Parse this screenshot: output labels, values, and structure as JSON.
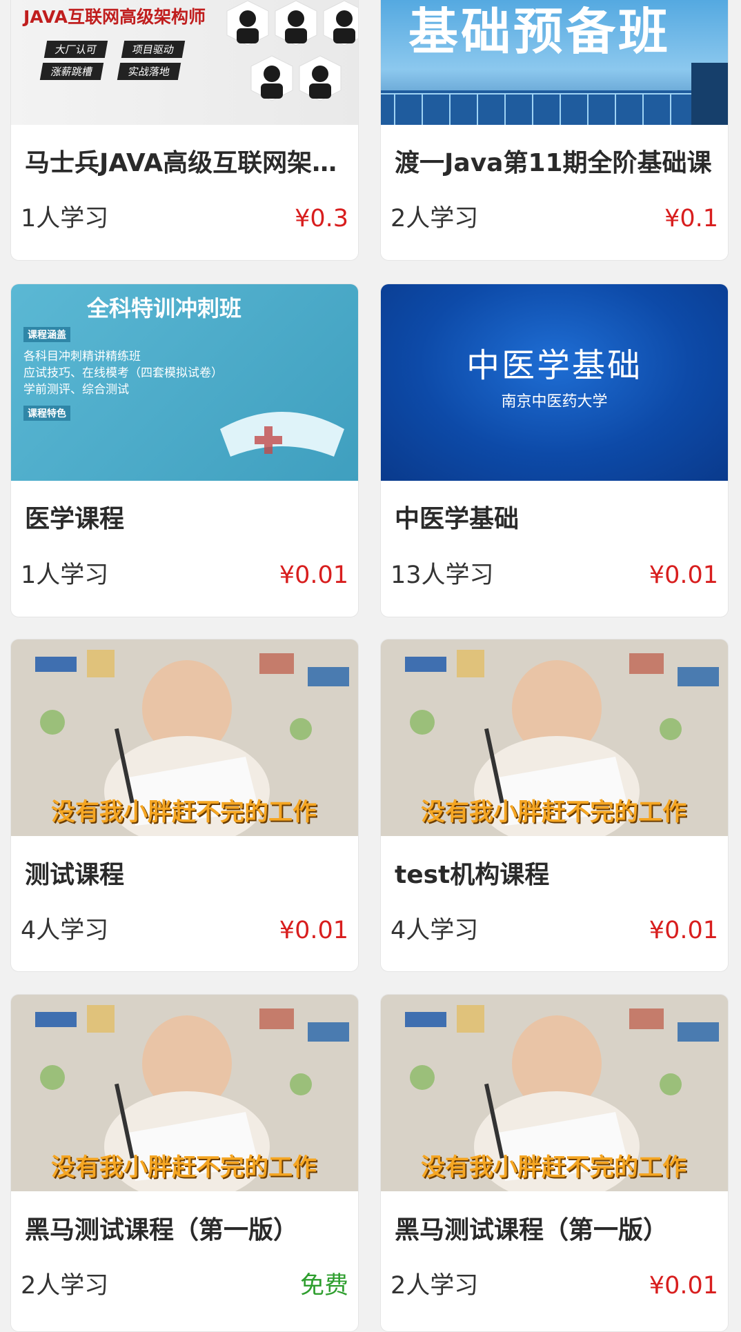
{
  "courses": [
    {
      "cover": {
        "line1": "JAVA互联网高级架构师",
        "tags": [
          "大厂认可",
          "项目驱动",
          "涨薪跳槽",
          "实战落地"
        ]
      },
      "title": "马士兵JAVA高级互联网架…",
      "learners": "1人学习",
      "price": "¥0.3"
    },
    {
      "cover": {
        "line1": "基础预备班"
      },
      "title": "渡一Java第11期全阶基础课",
      "learners": "2人学习",
      "price": "¥0.1"
    },
    {
      "cover": {
        "line1": "全科特训冲刺班",
        "line2": "课程涵盖",
        "line3": "各科目冲刺精讲精练班",
        "line4": "应试技巧、在线模考（四套模拟试卷）",
        "line5": "学前测评、综合测试",
        "line6": "课程特色"
      },
      "title": "医学课程",
      "learners": "1人学习",
      "price": "¥0.01"
    },
    {
      "cover": {
        "line1": "中医学基础",
        "line2": "南京中医药大学"
      },
      "title": "中医学基础",
      "learners": "13人学习",
      "price": "¥0.01"
    },
    {
      "cover": {
        "line1": "没有我小胖赶不完的工作"
      },
      "title": "测试课程",
      "learners": "4人学习",
      "price": "¥0.01"
    },
    {
      "cover": {
        "line1": "没有我小胖赶不完的工作"
      },
      "title": "test机构课程",
      "learners": "4人学习",
      "price": "¥0.01"
    },
    {
      "cover": {
        "line1": "没有我小胖赶不完的工作"
      },
      "title": "黑马测试课程（第一版）",
      "learners": "2人学习",
      "price": "免费"
    },
    {
      "cover": {
        "line1": "没有我小胖赶不完的工作"
      },
      "title": "黑马测试课程（第一版）",
      "learners": "2人学习",
      "price": "¥0.01"
    }
  ],
  "colors": {
    "price": "#d81e1e",
    "free": "#2e9e2e",
    "title": "#2a2a2a"
  }
}
